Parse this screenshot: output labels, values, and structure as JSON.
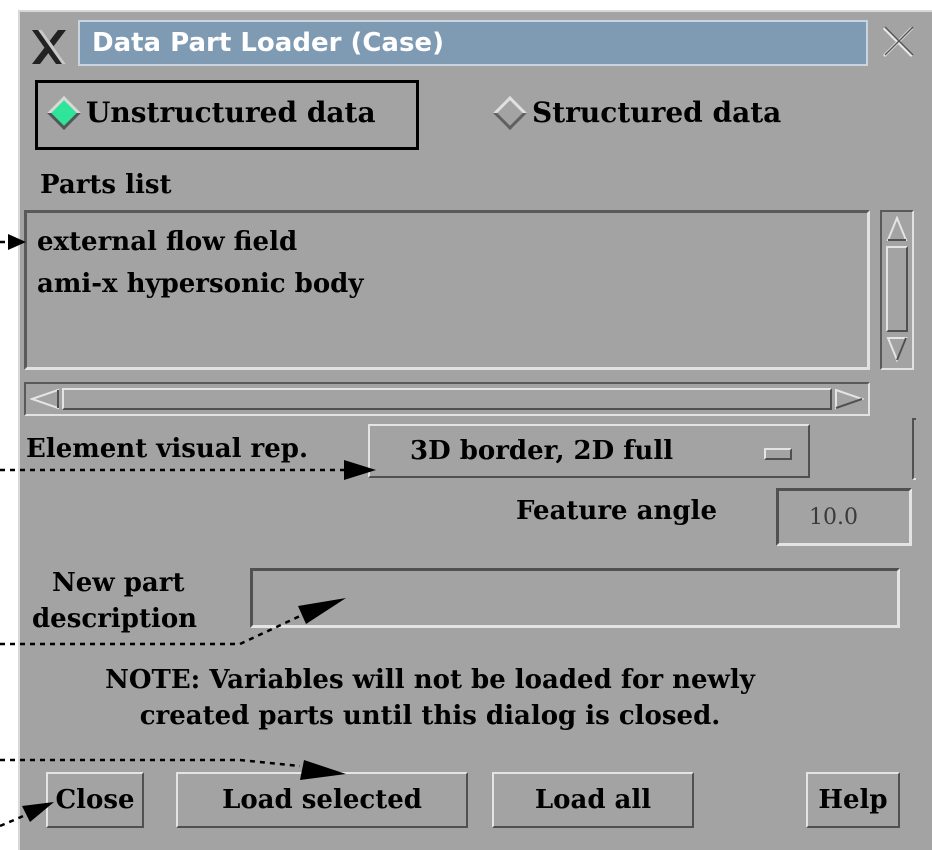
{
  "window": {
    "title": "Data Part Loader (Case)"
  },
  "data_type": {
    "options": [
      {
        "label": "Unstructured data",
        "selected": true
      },
      {
        "label": "Structured data",
        "selected": false
      }
    ],
    "selected_color": "#2ee59a"
  },
  "parts": {
    "label": "Parts list",
    "items": [
      "external flow field",
      "ami-x hypersonic body"
    ]
  },
  "visual_rep": {
    "label": "Element visual rep.",
    "value": "3D border, 2D full"
  },
  "feature_angle": {
    "label": "Feature angle",
    "value": "10.0"
  },
  "new_part": {
    "label_line1": "New part",
    "label_line2": "description",
    "value": ""
  },
  "note": {
    "line1": "NOTE: Variables will not be loaded for newly",
    "line2": "created parts until this dialog is closed."
  },
  "buttons": {
    "close": "Close",
    "load_selected": "Load selected",
    "load_all": "Load all",
    "help": "Help"
  },
  "colors": {
    "background": "#a3a3a3",
    "title_bar": "#7f9ab3"
  }
}
